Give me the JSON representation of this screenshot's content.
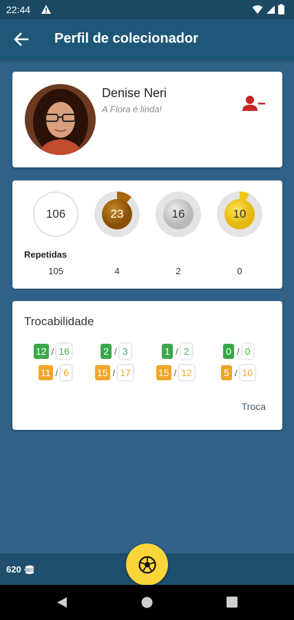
{
  "status_bar": {
    "time": "22:44"
  },
  "app_bar": {
    "title": "Perfil de colecionador"
  },
  "profile": {
    "name": "Denise Neri",
    "status": "A Flora é linda!"
  },
  "stats": {
    "circles": [
      {
        "value": "106",
        "progress": 0.02,
        "style": "white"
      },
      {
        "value": "23",
        "progress": 0.15,
        "style": "bronze"
      },
      {
        "value": "16",
        "progress": 0.0,
        "style": "silver"
      },
      {
        "value": "10",
        "progress": 0.1,
        "style": "gold"
      }
    ],
    "repeated_label": "Repetidas",
    "repeated": [
      "105",
      "4",
      "2",
      "0"
    ]
  },
  "tradeability": {
    "title": "Trocabilidade",
    "columns": [
      {
        "green": [
          "12",
          "16"
        ],
        "orange": [
          "11",
          "6"
        ]
      },
      {
        "green": [
          "2",
          "3"
        ],
        "orange": [
          "15",
          "17"
        ]
      },
      {
        "green": [
          "1",
          "2"
        ],
        "orange": [
          "15",
          "12"
        ]
      },
      {
        "green": [
          "0",
          "0"
        ],
        "orange": [
          "5",
          "10"
        ]
      }
    ],
    "trade_button": "Troca"
  },
  "bottom": {
    "coins": "620"
  },
  "colors": {
    "app_bar": "#1f5778",
    "background": "#2f6286",
    "bronze": "#a8660f",
    "silver": "#c9c9c9",
    "gold": "#f2c417",
    "green": "#3aa84a",
    "orange": "#f0a52a",
    "fab": "#fbd53a"
  }
}
